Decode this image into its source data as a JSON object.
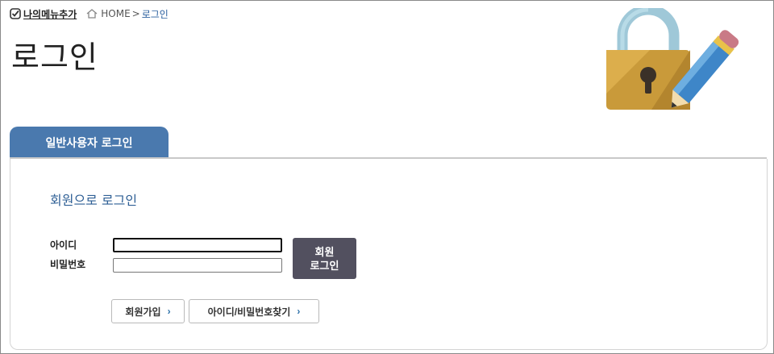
{
  "top_bar": {
    "my_menu_label": "나의메뉴추가"
  },
  "breadcrumb": {
    "home": "HOME",
    "separator": ">",
    "current": "로그인"
  },
  "page": {
    "title": "로그인"
  },
  "tab": {
    "label": "일반사용자 로그인"
  },
  "login_section": {
    "title": "회원으로 로그인",
    "id_label": "아이디",
    "pw_label": "비밀번호",
    "id_value": "",
    "pw_value": "",
    "login_button_line1": "회원",
    "login_button_line2": "로그인"
  },
  "actions": {
    "join_label": "회원가입",
    "find_label": "아이디/비밀번호찾기",
    "chevron": "›"
  },
  "colors": {
    "tab_bg": "#4a79ae",
    "section_title": "#2e5f95",
    "login_button": "#52505f"
  },
  "icons": [
    "check-icon",
    "home-icon",
    "lock-pencil-illustration",
    "chevron-right-icon"
  ]
}
